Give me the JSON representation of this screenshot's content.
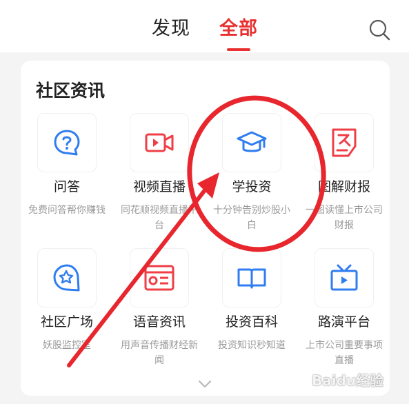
{
  "header": {
    "tabs": [
      {
        "label": "发现",
        "active": false
      },
      {
        "label": "全部",
        "active": true
      }
    ],
    "search_icon": "search-icon"
  },
  "section": {
    "title": "社区资讯",
    "items": [
      {
        "title": "问答",
        "desc": "免费问答帮你赚钱",
        "icon": "question-bubble-icon"
      },
      {
        "title": "视频直播",
        "desc": "同花顺视频直播平台",
        "icon": "video-camera-icon"
      },
      {
        "title": "学投资",
        "desc": "十分钟告别炒股小白",
        "icon": "graduation-cap-icon"
      },
      {
        "title": "图解财报",
        "desc": "一图读懂上市公司财报",
        "icon": "chart-report-icon"
      },
      {
        "title": "社区广场",
        "desc": "妖股监控室",
        "icon": "star-bubble-icon"
      },
      {
        "title": "语音资讯",
        "desc": "用声音传播财经新闻",
        "icon": "radio-icon"
      },
      {
        "title": "投资百科",
        "desc": "投资知识秒知道",
        "icon": "open-book-icon"
      },
      {
        "title": "路演平台",
        "desc": "上市公司重要事项直播",
        "icon": "tv-icon"
      }
    ],
    "expand_icon": "chevron-down-icon"
  },
  "colors": {
    "accent": "#e93030",
    "icon_blue": "#2f7df0",
    "icon_red": "#ef3e46"
  },
  "watermark": "Baidu经验"
}
